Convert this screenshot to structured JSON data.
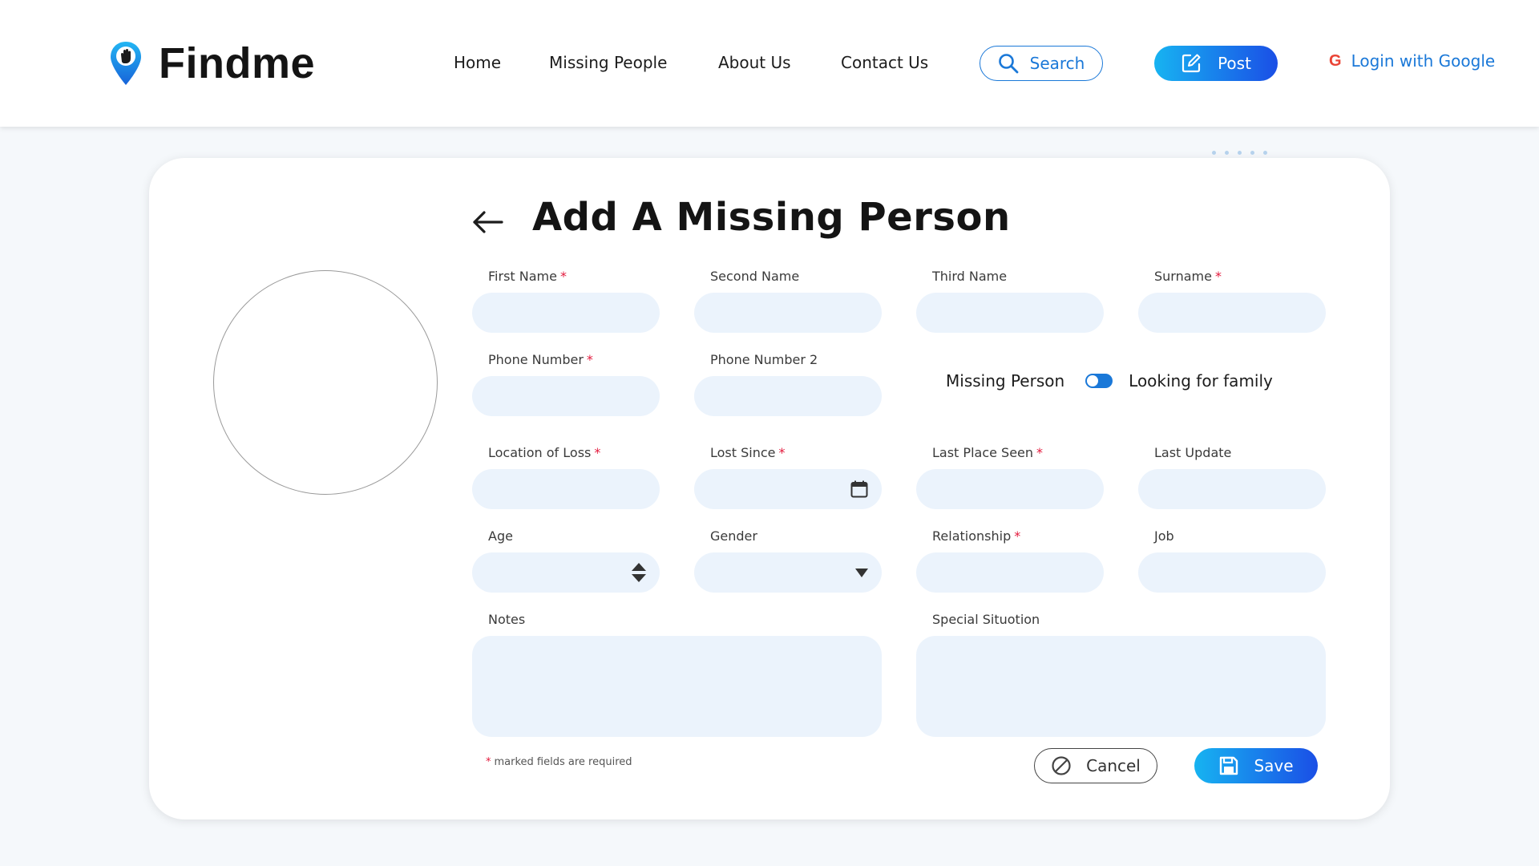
{
  "brand": {
    "name": "Findme",
    "accent": "#1a78d8",
    "gradient_start": "#17b3f1",
    "gradient_end": "#1a4fe6"
  },
  "nav": {
    "links": [
      "Home",
      "Missing People",
      "About Us",
      "Contact Us"
    ],
    "search_label": "Search",
    "post_label": "Post",
    "login_label": "Login with Google",
    "login_icon": "google-icon"
  },
  "form": {
    "title": "Add A Missing Person",
    "fields": {
      "first_name": {
        "label": "First Name",
        "required": "*",
        "value": ""
      },
      "second_name": {
        "label": "Second Name",
        "value": ""
      },
      "third_name": {
        "label": "Third Name",
        "value": ""
      },
      "surname": {
        "label": "Surname",
        "required": "*",
        "value": ""
      },
      "phone_number": {
        "label": "Phone Number",
        "required": "*",
        "value": ""
      },
      "phone_number_2": {
        "label": "Phone Number 2",
        "value": ""
      },
      "location_of_loss": {
        "label": "Location of Loss",
        "required": "*",
        "value": ""
      },
      "lost_since": {
        "label": "Lost Since",
        "required": "*",
        "value": "",
        "icon": "calendar-icon"
      },
      "last_place_seen": {
        "label": "Last Place Seen",
        "required": "*",
        "value": ""
      },
      "last_update": {
        "label": "Last Update",
        "value": ""
      },
      "age": {
        "label": "Age",
        "value": "",
        "icon": "stepper-icon"
      },
      "gender": {
        "label": "Gender",
        "value": "",
        "icon": "dropdown-arrow-icon"
      },
      "relationship": {
        "label": "Relationship",
        "required": "*",
        "value": ""
      },
      "job": {
        "label": "Job",
        "value": ""
      },
      "notes": {
        "label": "Notes",
        "value": ""
      },
      "special_situation": {
        "label": "Special Situotion",
        "value": ""
      }
    },
    "toggle": {
      "left_label": "Missing Person",
      "right_label": "Looking for family",
      "state": "on"
    },
    "required_note": {
      "star": "*",
      "text": "marked fields are required"
    },
    "cancel_label": "Cancel",
    "save_label": "Save"
  }
}
